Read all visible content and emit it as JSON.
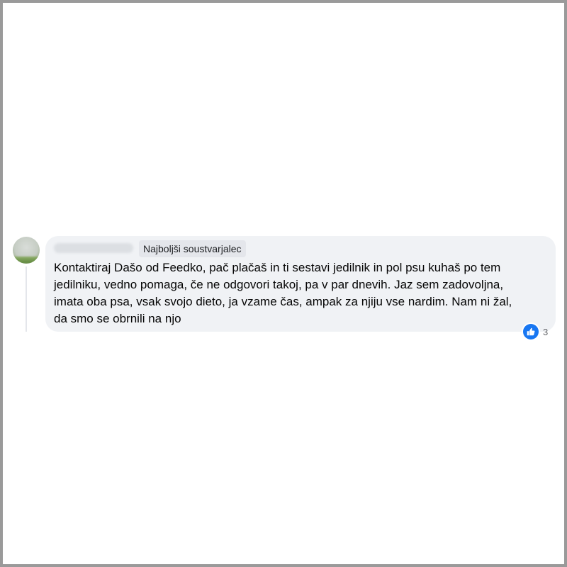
{
  "comment": {
    "author_name": "",
    "badge": "Najboljši soustvarjalec",
    "text_lines": [
      "Kontaktiraj Dašo od Feedko, pač plačaš in ti sestavi jedilnik in pol psu kuhaš po tem",
      "jedilniku, vedno pomaga, če ne odgovori takoj, pa v par dnevih. Jaz sem zadovoljna,",
      "imata oba psa, vsak svojo dieto, ja vzame čas, ampak za njiju vse nardim. Nam ni žal,",
      "da smo se obrnili na njo"
    ],
    "reactions": {
      "icon": "like-icon",
      "count": "3",
      "color": "#1877f2"
    }
  },
  "colors": {
    "bubble": "#f0f2f5",
    "badge_bg": "#e4e6eb",
    "border": "#9a9a9a"
  }
}
